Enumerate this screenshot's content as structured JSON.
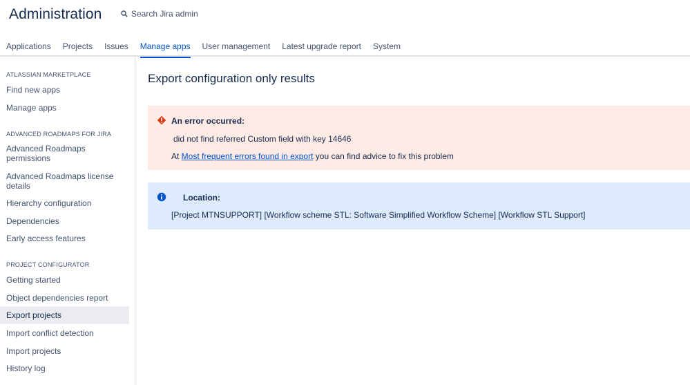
{
  "header": {
    "title": "Administration",
    "search_placeholder": "Search Jira admin"
  },
  "tabs": [
    {
      "label": "Applications"
    },
    {
      "label": "Projects"
    },
    {
      "label": "Issues"
    },
    {
      "label": "Manage apps",
      "active": true
    },
    {
      "label": "User management"
    },
    {
      "label": "Latest upgrade report"
    },
    {
      "label": "System"
    }
  ],
  "sidebar": {
    "sections": [
      {
        "title": "ATLASSIAN MARKETPLACE",
        "items": [
          {
            "label": "Find new apps"
          },
          {
            "label": "Manage apps"
          }
        ]
      },
      {
        "title": "ADVANCED ROADMAPS FOR JIRA",
        "items": [
          {
            "label": "Advanced Roadmaps permissions"
          },
          {
            "label": "Advanced Roadmaps license details"
          },
          {
            "label": "Hierarchy configuration"
          },
          {
            "label": "Dependencies"
          },
          {
            "label": "Early access features"
          }
        ]
      },
      {
        "title": "PROJECT CONFIGURATOR",
        "items": [
          {
            "label": "Getting started"
          },
          {
            "label": "Object dependencies report"
          },
          {
            "label": "Export projects",
            "active": true
          },
          {
            "label": "Import conflict detection"
          },
          {
            "label": "Import projects"
          },
          {
            "label": "History log"
          }
        ]
      }
    ]
  },
  "main": {
    "title": "Export configuration only results",
    "error": {
      "heading": "An error occurred:",
      "detail": "did not find referred Custom field with key 14646",
      "advice_prefix": "At ",
      "advice_link": "Most frequent errors found in export",
      "advice_suffix": " you can find advice to fix this problem"
    },
    "location": {
      "heading": "Location:",
      "detail": "[Project MTNSUPPORT] [Workflow scheme STL: Software Simplified Workflow Scheme] [Workflow STL Support]"
    }
  },
  "colors": {
    "accent": "#0052cc",
    "error_bg": "#ffebe6",
    "error_icon": "#de350b",
    "info_bg": "#deebff",
    "info_icon": "#0052cc"
  }
}
